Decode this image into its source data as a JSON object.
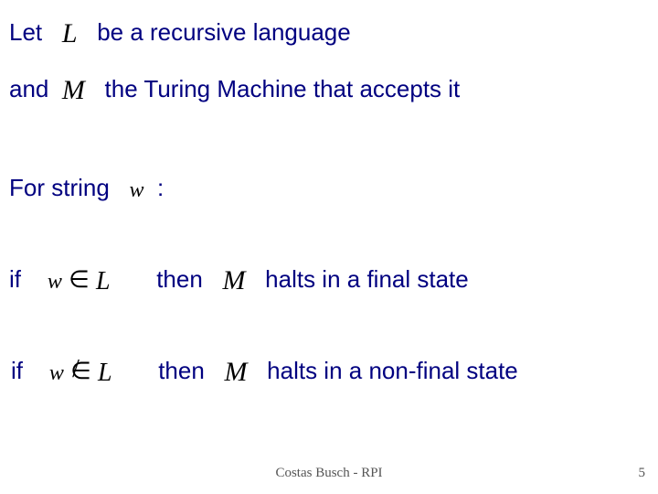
{
  "line1": {
    "a": "Let",
    "b": "be a recursive language"
  },
  "line2": {
    "a": "and",
    "b": "the Turing Machine that accepts it"
  },
  "line3": {
    "a": "For string",
    "b": ":"
  },
  "line4": {
    "a": "if",
    "b": "then",
    "c": "halts in a final state"
  },
  "line5": {
    "a": "if",
    "b": "then",
    "c": "halts in a non-final state"
  },
  "sym": {
    "L": "L",
    "M": "M",
    "w": "w",
    "in": "∈",
    "notin_base": "∈",
    "slash": "/"
  },
  "footer": "Costas Busch - RPI",
  "page": "5"
}
